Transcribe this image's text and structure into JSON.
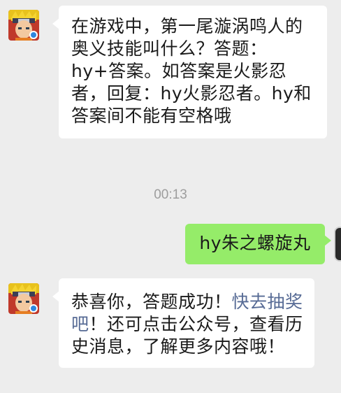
{
  "messages": [
    {
      "id": "bot-question",
      "text": "在游戏中，第一尾漩涡鸣人的奥义技能叫什么？答题：hy+答案。如答案是火影忍者，回复：hy火影忍者。hy和答案间不能有空格哦"
    },
    {
      "id": "user-answer",
      "text": "hy朱之螺旋丸"
    },
    {
      "id": "bot-reply",
      "text_before": "恭喜你，答题成功！",
      "link_text": "快去抽奖吧",
      "text_after": "！还可点击公众号，查看历史消息，了解更多内容哦！"
    }
  ],
  "timestamp": "00:13",
  "colors": {
    "background": "#ededed",
    "incoming_bubble": "#ffffff",
    "outgoing_bubble": "#95ec69",
    "link": "#576b95",
    "timestamp": "#9d9d9d"
  },
  "icons": {
    "bot_avatar": "ninja-character-avatar-icon",
    "user_avatar": "user-avatar-icon"
  }
}
